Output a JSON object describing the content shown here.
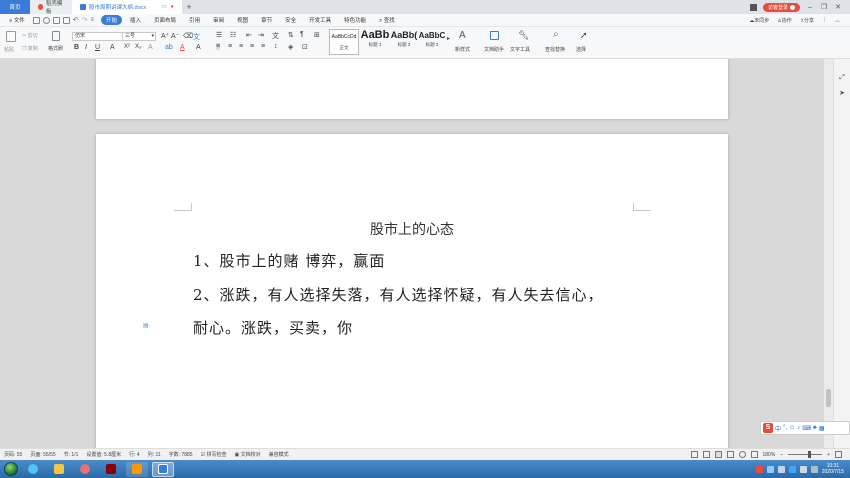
{
  "tabs": {
    "home": "首页",
    "template": "稻壳模板",
    "document": "股市周期讲课大纲.docx",
    "login": "访客登录"
  },
  "menu": {
    "file": "≡ 文件",
    "items": [
      "开始",
      "插入",
      "页面布局",
      "引用",
      "审阅",
      "视图",
      "章节",
      "安全",
      "开发工具",
      "特色功能"
    ],
    "search": "查找",
    "sync": "未同步",
    "collab": "协作",
    "share": "分享"
  },
  "ribbon": {
    "paste": "粘贴",
    "cut": "剪切",
    "copy": "复制",
    "format_painter": "格式刷",
    "font_name": "仿宋",
    "font_size": "三号",
    "styles": [
      {
        "sample": "AaBbCcDd",
        "caption": "正文"
      },
      {
        "sample": "AaBb",
        "caption": "标题 1"
      },
      {
        "sample": "AaBb(",
        "caption": "标题 2"
      },
      {
        "sample": "AaBbC",
        "caption": "标题 3"
      }
    ],
    "new_style": "新样式",
    "doc_assistant": "文档助手",
    "text_tools": "文字工具",
    "find_replace": "查找替换",
    "select": "选择"
  },
  "document": {
    "title": "股市上的心态",
    "lines": [
      "1、股市上的赌 博弈，赢面",
      "2、涨跌，有人选择失落，有人选择怀疑，有人失去信心，",
      "耐心。涨跌，买卖，你"
    ]
  },
  "statusbar": {
    "page": "页码: 55",
    "pages": "页面: 55/55",
    "section": "节: 1/1",
    "position": "设置值: 5.8厘米",
    "row": "行: 4",
    "col": "列: 11",
    "word_count": "字数: 7885",
    "spell_check": "拼写检查",
    "doc_check": "文档校对",
    "compat": "兼容模式",
    "zoom": "180%"
  },
  "ime": {
    "label": "中"
  },
  "taskbar": {
    "clock_time": "10:31",
    "clock_date": "2020/7/15"
  },
  "colors": {
    "accent": "#3a7bd5",
    "login": "#e74c3c",
    "taskbar": "#2b6aa8"
  }
}
